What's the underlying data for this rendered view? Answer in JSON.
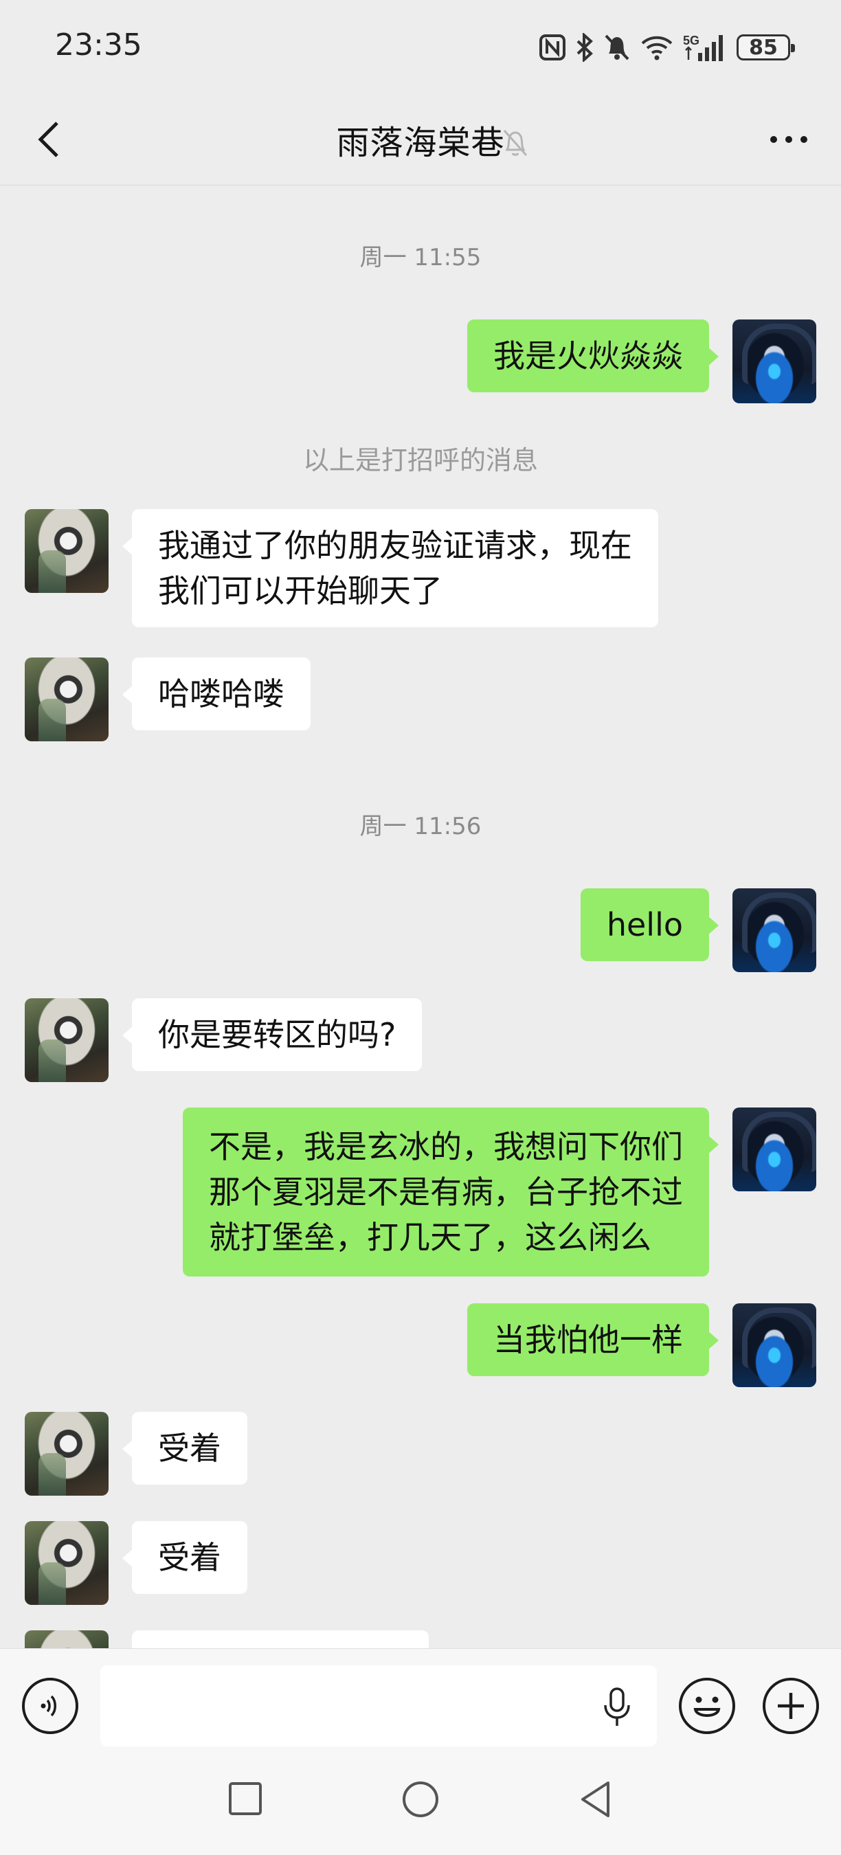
{
  "status_bar": {
    "time": "23:35",
    "battery": "85",
    "network": "5G",
    "icons": [
      "nfc-icon",
      "bluetooth-icon",
      "bell-off-icon",
      "wifi-icon",
      "signal-icon",
      "battery-icon"
    ]
  },
  "header": {
    "title": "雨落海棠巷",
    "back_icon": "chevron-left-icon",
    "mute_icon": "bell-off-icon",
    "more_icon": "ellipsis-icon"
  },
  "messages": [
    {
      "type": "time",
      "text": "周一 11:55"
    },
    {
      "type": "msg",
      "from": "me",
      "text": "我是火炏焱焱"
    },
    {
      "type": "system",
      "text": "以上是打招呼的消息"
    },
    {
      "type": "msg",
      "from": "friend",
      "lines": [
        "我通过了你的朋友验证请求，现在",
        "我们可以开始聊天了"
      ]
    },
    {
      "type": "msg",
      "from": "friend",
      "text": "哈喽哈喽"
    },
    {
      "type": "time",
      "text": "周一 11:56"
    },
    {
      "type": "msg",
      "from": "me",
      "text": "hello"
    },
    {
      "type": "msg",
      "from": "friend",
      "text": "你是要转区的吗?"
    },
    {
      "type": "msg",
      "from": "me",
      "lines": [
        "不是，我是玄冰的，我想问下你们",
        "那个夏羽是不是有病，台子抢不过",
        "就打堡垒，打几天了，这么闲么"
      ]
    },
    {
      "type": "msg",
      "from": "me",
      "text": "当我怕他一样"
    },
    {
      "type": "msg",
      "from": "friend",
      "text": "受着"
    },
    {
      "type": "msg",
      "from": "friend",
      "text": "受着"
    }
  ],
  "input_bar": {
    "value": "",
    "voice_icon": "voice-icon",
    "mic_icon": "microphone-icon",
    "emoji_icon": "emoji-icon",
    "plus_icon": "plus-icon"
  },
  "nav_bar": {
    "icons": [
      "recent-apps-icon",
      "home-icon",
      "back-icon"
    ]
  },
  "colors": {
    "background": "#ededed",
    "my_bubble": "#95ec69",
    "friend_bubble": "#ffffff",
    "meta_text": "#8a8a8a"
  }
}
